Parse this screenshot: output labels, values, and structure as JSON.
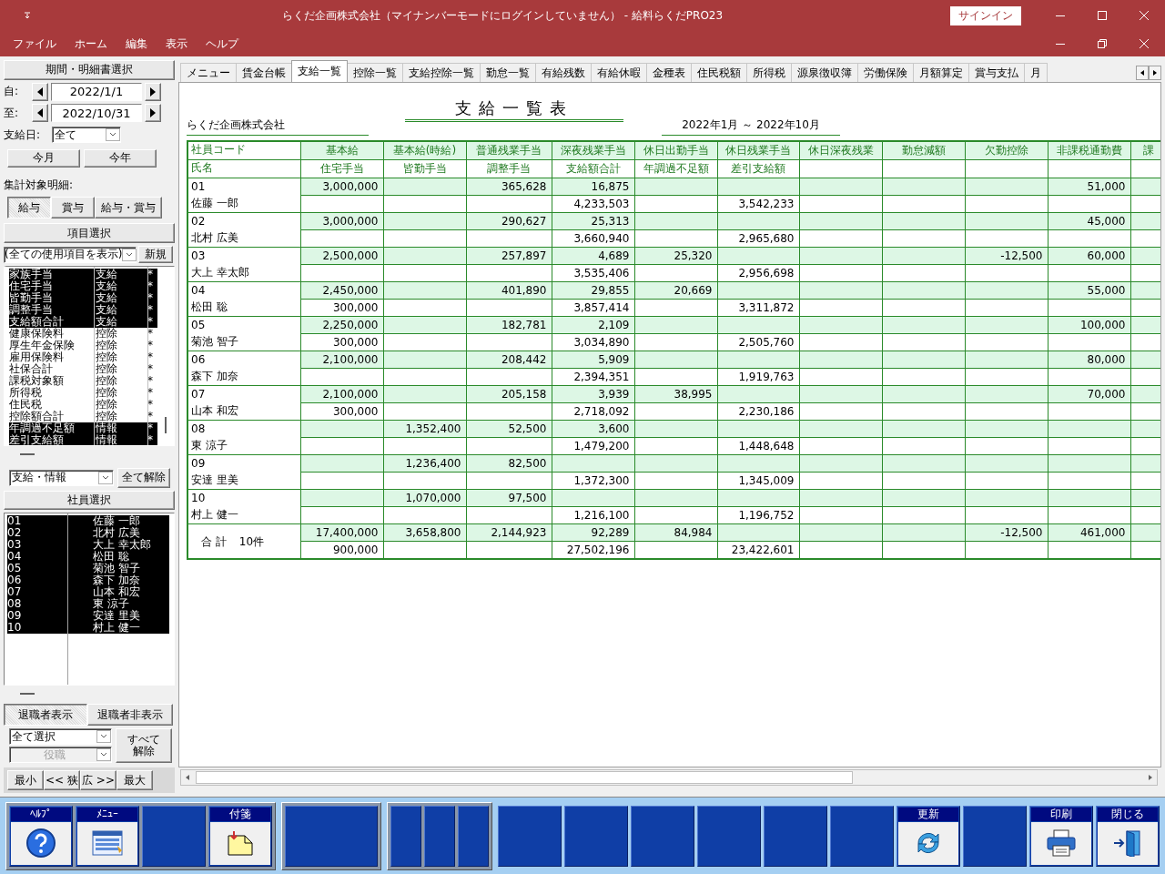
{
  "window": {
    "title": "らくだ企画株式会社（マイナンバーモードにログインしていません） - 給料らくだPRO23",
    "sign_in": "サインイン"
  },
  "menu_bar": [
    "ファイル",
    "ホーム",
    "編集",
    "表示",
    "ヘルプ"
  ],
  "side_panel": {
    "period_header": "期間・明細書選択",
    "from": {
      "label": "自:",
      "value": "2022/1/1"
    },
    "to": {
      "label": "至:",
      "value": "2022/10/31"
    },
    "pay_day": {
      "label": "支給日:",
      "value": "全て"
    },
    "quick_buttons": [
      "今月",
      "今年"
    ],
    "target_label": "集計対象明細:",
    "target_options": [
      {
        "label": "給与",
        "selected": true
      },
      {
        "label": "賞与",
        "selected": false
      },
      {
        "label": "給与・賞与",
        "selected": false
      }
    ],
    "item_header": "項目選択",
    "item_filter": "(全ての使用項目を表示)",
    "new_button": "新規",
    "items": [
      {
        "name": "家族手当",
        "category": "支給",
        "mark": "*",
        "selected": true
      },
      {
        "name": "住宅手当",
        "category": "支給",
        "mark": "*",
        "selected": true
      },
      {
        "name": "皆勤手当",
        "category": "支給",
        "mark": "*",
        "selected": true
      },
      {
        "name": "調整手当",
        "category": "支給",
        "mark": "*",
        "selected": true
      },
      {
        "name": "支給額合計",
        "category": "支給",
        "mark": "*",
        "selected": true
      },
      {
        "name": "健康保険料",
        "category": "控除",
        "mark": "*",
        "selected": false
      },
      {
        "name": "厚生年金保険",
        "category": "控除",
        "mark": "*",
        "selected": false
      },
      {
        "name": "雇用保険料",
        "category": "控除",
        "mark": "*",
        "selected": false
      },
      {
        "name": "社保合計",
        "category": "控除",
        "mark": "*",
        "selected": false
      },
      {
        "name": "課税対象額",
        "category": "控除",
        "mark": "*",
        "selected": false
      },
      {
        "name": "所得税",
        "category": "控除",
        "mark": "*",
        "selected": false
      },
      {
        "name": "住民税",
        "category": "控除",
        "mark": "*",
        "selected": false
      },
      {
        "name": "控除額合計",
        "category": "控除",
        "mark": "*",
        "selected": false
      },
      {
        "name": "年調過不足額",
        "category": "情報",
        "mark": "*",
        "selected": true
      },
      {
        "name": "差引支給額",
        "category": "情報",
        "mark": "*",
        "selected": true
      }
    ],
    "item_category_filter": "支給・情報",
    "clear_button": "全て解除",
    "employee_header": "社員選択",
    "employees": [
      {
        "code": "01",
        "name": "佐藤 一郎",
        "selected": true
      },
      {
        "code": "02",
        "name": "北村 広美",
        "selected": true
      },
      {
        "code": "03",
        "name": "大上 幸太郎",
        "selected": true
      },
      {
        "code": "04",
        "name": "松田 聡",
        "selected": true
      },
      {
        "code": "05",
        "name": "菊池 智子",
        "selected": true
      },
      {
        "code": "06",
        "name": "森下 加奈",
        "selected": true
      },
      {
        "code": "07",
        "name": "山本 和宏",
        "selected": true
      },
      {
        "code": "08",
        "name": "東 涼子",
        "selected": true
      },
      {
        "code": "09",
        "name": "安達 里美",
        "selected": true
      },
      {
        "code": "10",
        "name": "村上 健一",
        "selected": true
      }
    ],
    "retired_options": [
      {
        "label": "退職者表示",
        "selected": true
      },
      {
        "label": "退職者非表示",
        "selected": false
      }
    ],
    "select_filter": "全て選択",
    "position_filter": {
      "placeholder": "役職",
      "disabled": true
    },
    "clear_all_button": "すべて解除",
    "width_buttons": [
      "最小",
      "<< 狭",
      "広 >>",
      "最大"
    ]
  },
  "tabs": [
    {
      "label": "メニュー",
      "selected": false
    },
    {
      "label": "賃金台帳",
      "selected": false
    },
    {
      "label": "支給一覧",
      "selected": true
    },
    {
      "label": "控除一覧",
      "selected": false
    },
    {
      "label": "支給控除一覧",
      "selected": false
    },
    {
      "label": "勤怠一覧",
      "selected": false
    },
    {
      "label": "有給残数",
      "selected": false
    },
    {
      "label": "有給休暇",
      "selected": false
    },
    {
      "label": "金種表",
      "selected": false
    },
    {
      "label": "住民税額",
      "selected": false
    },
    {
      "label": "所得税",
      "selected": false
    },
    {
      "label": "源泉徴収簿",
      "selected": false
    },
    {
      "label": "労働保険",
      "selected": false
    },
    {
      "label": "月額算定",
      "selected": false
    },
    {
      "label": "賞与支払",
      "selected": false
    },
    {
      "label": "月",
      "selected": false
    }
  ],
  "report": {
    "title": "支給一覧表",
    "company": "らくだ企画株式会社",
    "period": "2022年1月 ～ 2022年10月",
    "code_header": "社員コード",
    "name_header": "氏名",
    "columns": [
      {
        "top": "基本給",
        "bottom": "住宅手当"
      },
      {
        "top": "基本給(時給)",
        "bottom": "皆勤手当"
      },
      {
        "top": "普通残業手当",
        "bottom": "調整手当"
      },
      {
        "top": "深夜残業手当",
        "bottom": "支給額合計"
      },
      {
        "top": "休日出勤手当",
        "bottom": "年調過不足額"
      },
      {
        "top": "休日残業手当",
        "bottom": "差引支給額"
      },
      {
        "top": "休日深夜残業"
      },
      {
        "top": "勤怠減額"
      },
      {
        "top": "欠勤控除"
      },
      {
        "top": "非課税通勤費"
      },
      {
        "top": "課"
      }
    ],
    "rows": [
      {
        "code": "01",
        "name": "佐藤 一郎",
        "basic_pay": "3,000,000",
        "overtime": "365,628",
        "night_overtime": "16,875",
        "commute": "51,000",
        "total_pay": "4,233,503",
        "net_pay": "3,542,233"
      },
      {
        "code": "02",
        "name": "北村 広美",
        "basic_pay": "3,000,000",
        "overtime": "290,627",
        "night_overtime": "25,313",
        "commute": "45,000",
        "total_pay": "3,660,940",
        "net_pay": "2,965,680"
      },
      {
        "code": "03",
        "name": "大上 幸太郎",
        "basic_pay": "2,500,000",
        "overtime": "257,897",
        "night_overtime": "4,689",
        "holiday_work": "25,320",
        "absence_deduction": "-12,500",
        "commute": "60,000",
        "total_pay": "3,535,406",
        "net_pay": "2,956,698"
      },
      {
        "code": "04",
        "name": "松田 聡",
        "basic_pay": "2,450,000",
        "overtime": "401,890",
        "night_overtime": "29,855",
        "holiday_work": "20,669",
        "commute": "55,000",
        "housing": "300,000",
        "total_pay": "3,857,414",
        "net_pay": "3,311,872"
      },
      {
        "code": "05",
        "name": "菊池 智子",
        "basic_pay": "2,250,000",
        "overtime": "182,781",
        "night_overtime": "2,109",
        "commute": "100,000",
        "housing": "300,000",
        "total_pay": "3,034,890",
        "net_pay": "2,505,760"
      },
      {
        "code": "06",
        "name": "森下 加奈",
        "basic_pay": "2,100,000",
        "overtime": "208,442",
        "night_overtime": "5,909",
        "commute": "80,000",
        "total_pay": "2,394,351",
        "net_pay": "1,919,763"
      },
      {
        "code": "07",
        "name": "山本 和宏",
        "basic_pay": "2,100,000",
        "overtime": "205,158",
        "night_overtime": "3,939",
        "holiday_work": "38,995",
        "commute": "70,000",
        "housing": "300,000",
        "total_pay": "2,718,092",
        "net_pay": "2,230,186"
      },
      {
        "code": "08",
        "name": "東 涼子",
        "hourly_pay": "1,352,400",
        "overtime": "52,500",
        "night_overtime": "3,600",
        "total_pay": "1,479,200",
        "net_pay": "1,448,648"
      },
      {
        "code": "09",
        "name": "安達 里美",
        "hourly_pay": "1,236,400",
        "overtime": "82,500",
        "total_pay": "1,372,300",
        "net_pay": "1,345,009"
      },
      {
        "code": "10",
        "name": "村上 健一",
        "hourly_pay": "1,070,000",
        "overtime": "97,500",
        "total_pay": "1,216,100",
        "net_pay": "1,196,752"
      }
    ],
    "total": {
      "label": "合 計",
      "count": "10件",
      "basic_pay": "17,400,000",
      "hourly_pay": "3,658,800",
      "overtime": "2,144,923",
      "night_overtime": "92,289",
      "holiday_work": "84,984",
      "absence_deduction": "-12,500",
      "commute": "461,000",
      "housing": "900,000",
      "total_pay": "27,502,196",
      "net_pay": "23,422,601"
    }
  },
  "toolbar": {
    "groups": [
      {
        "kind": "framed",
        "buttons": [
          {
            "label": "ﾍﾙﾌﾟ",
            "kind": "help"
          },
          {
            "label": "ﾒﾆｭｰ",
            "kind": "menu"
          },
          {
            "kind": "empty"
          },
          {
            "label": "付箋",
            "kind": "note"
          }
        ]
      },
      {
        "kind": "framed",
        "buttons": [
          {
            "kind": "wide"
          }
        ]
      },
      {
        "kind": "framed",
        "buttons": [
          {
            "kind": "narrow"
          },
          {
            "kind": "narrow"
          },
          {
            "kind": "narrow"
          }
        ]
      },
      {
        "kind": "plain",
        "buttons": [
          {
            "kind": "empty"
          },
          {
            "kind": "empty"
          },
          {
            "kind": "empty"
          },
          {
            "kind": "empty"
          },
          {
            "kind": "empty"
          },
          {
            "kind": "empty"
          },
          {
            "label": "更新",
            "kind": "refresh"
          },
          {
            "kind": "empty"
          },
          {
            "label": "印刷",
            "kind": "print"
          },
          {
            "label": "閉じる",
            "kind": "close"
          }
        ]
      }
    ]
  }
}
